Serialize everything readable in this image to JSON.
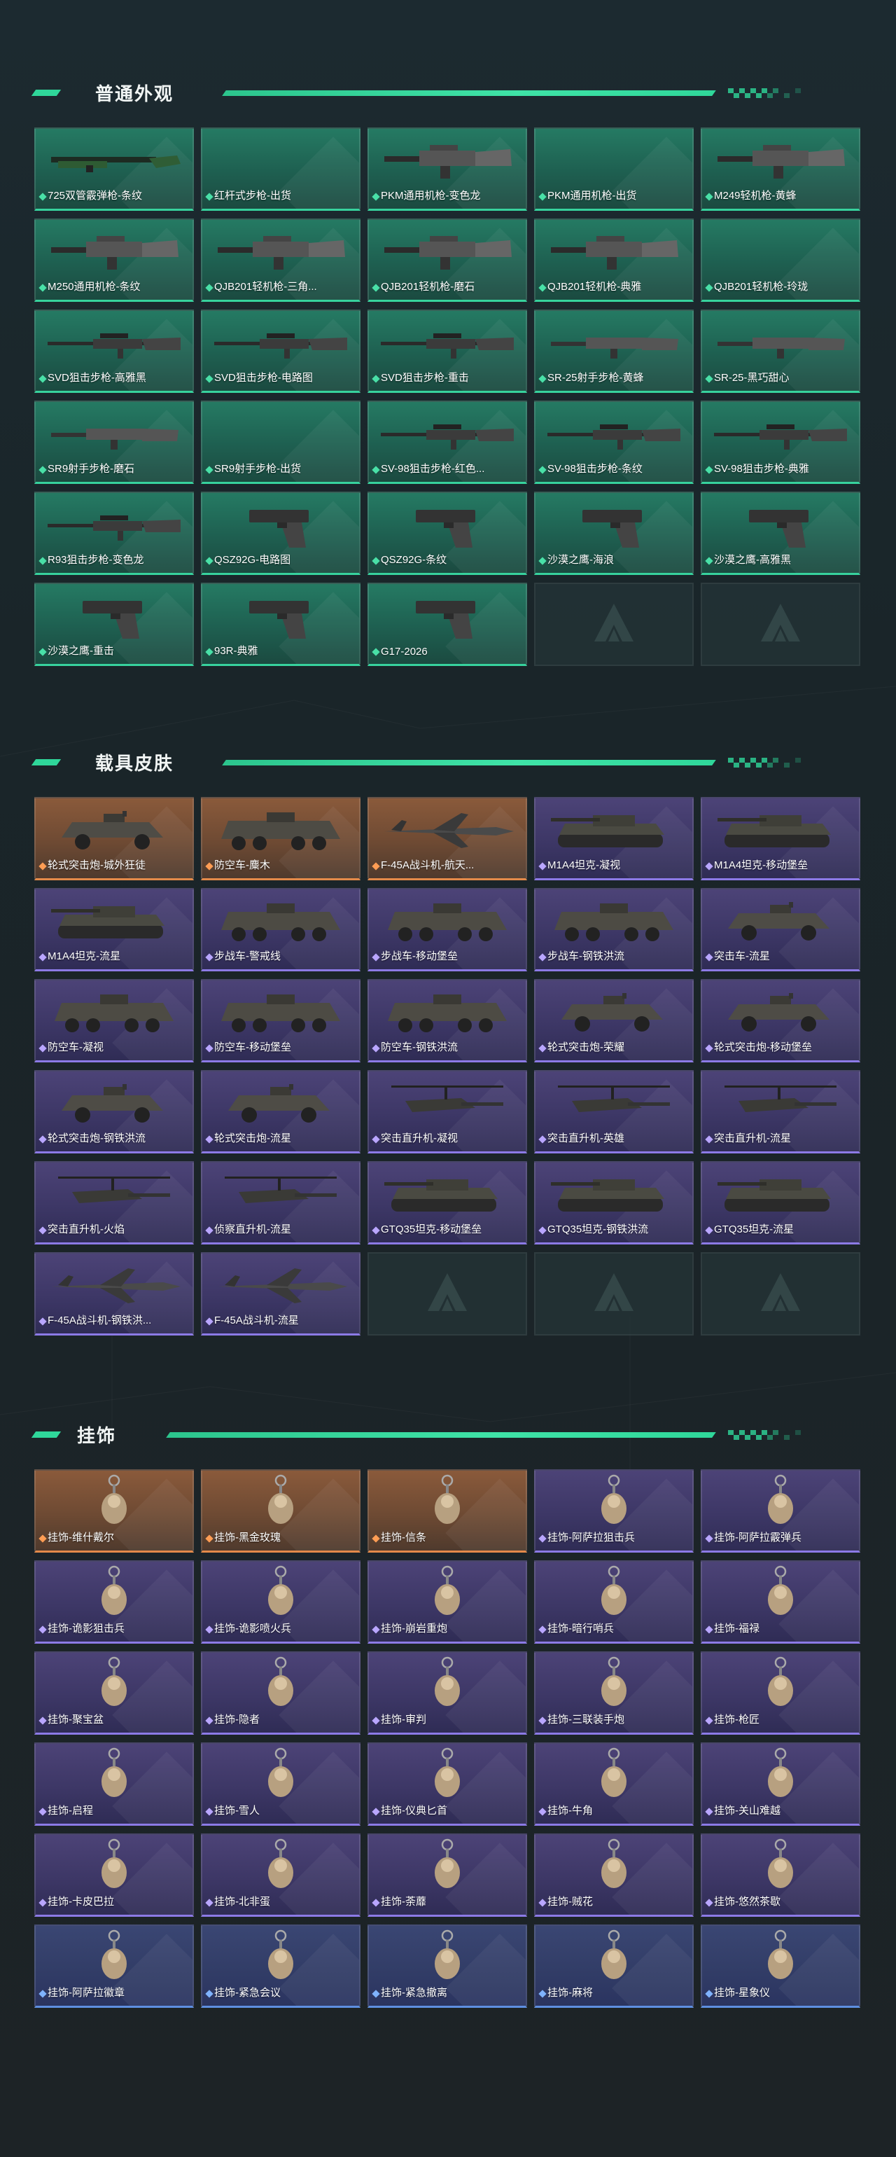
{
  "sections": [
    {
      "title": "普通外观",
      "items": [
        {
          "label": "725双管霰弹枪-条纹",
          "rarity": "green",
          "icon": "shotgun-icon"
        },
        {
          "label": "红杆式步枪-出货",
          "rarity": "green",
          "icon": "empty"
        },
        {
          "label": "PKM通用机枪-变色龙",
          "rarity": "green",
          "icon": "machine-gun-icon"
        },
        {
          "label": "PKM通用机枪-出货",
          "rarity": "green",
          "icon": "empty"
        },
        {
          "label": "M249轻机枪-黄蜂",
          "rarity": "green",
          "icon": "machine-gun-icon"
        },
        {
          "label": "M250通用机枪-条纹",
          "rarity": "green",
          "icon": "machine-gun-icon"
        },
        {
          "label": "QJB201轻机枪-三角...",
          "rarity": "green",
          "icon": "machine-gun-icon"
        },
        {
          "label": "QJB201轻机枪-磨石",
          "rarity": "green",
          "icon": "machine-gun-icon"
        },
        {
          "label": "QJB201轻机枪-典雅",
          "rarity": "green",
          "icon": "machine-gun-icon"
        },
        {
          "label": "QJB201轻机枪-玲珑",
          "rarity": "green",
          "icon": "empty"
        },
        {
          "label": "SVD狙击步枪-高雅黑",
          "rarity": "green",
          "icon": "sniper-rifle-icon"
        },
        {
          "label": "SVD狙击步枪-电路图",
          "rarity": "green",
          "icon": "sniper-rifle-icon"
        },
        {
          "label": "SVD狙击步枪-重击",
          "rarity": "green",
          "icon": "sniper-rifle-icon"
        },
        {
          "label": "SR-25射手步枪-黄蜂",
          "rarity": "green",
          "icon": "rifle-icon"
        },
        {
          "label": "SR-25-黑巧甜心",
          "rarity": "green",
          "icon": "rifle-icon"
        },
        {
          "label": "SR9射手步枪-磨石",
          "rarity": "green",
          "icon": "rifle-icon"
        },
        {
          "label": "SR9射手步枪-出货",
          "rarity": "green",
          "icon": "empty"
        },
        {
          "label": "SV-98狙击步枪-红色...",
          "rarity": "green",
          "icon": "sniper-rifle-icon"
        },
        {
          "label": "SV-98狙击步枪-条纹",
          "rarity": "green",
          "icon": "sniper-rifle-icon"
        },
        {
          "label": "SV-98狙击步枪-典雅",
          "rarity": "green",
          "icon": "sniper-rifle-icon"
        },
        {
          "label": "R93狙击步枪-变色龙",
          "rarity": "green",
          "icon": "sniper-rifle-icon"
        },
        {
          "label": "QSZ92G-电路图",
          "rarity": "green",
          "icon": "pistol-icon"
        },
        {
          "label": "QSZ92G-条纹",
          "rarity": "green",
          "icon": "pistol-icon"
        },
        {
          "label": "沙漠之鹰-海浪",
          "rarity": "green",
          "icon": "pistol-icon"
        },
        {
          "label": "沙漠之鹰-高雅黑",
          "rarity": "green",
          "icon": "pistol-icon"
        },
        {
          "label": "沙漠之鹰-重击",
          "rarity": "green",
          "icon": "pistol-icon"
        },
        {
          "label": "93R-典雅",
          "rarity": "green",
          "icon": "pistol-icon"
        },
        {
          "label": "G17-2026",
          "rarity": "green",
          "icon": "pistol-icon"
        },
        {
          "label": "",
          "rarity": "empty",
          "icon": "placeholder-logo-icon"
        },
        {
          "label": "",
          "rarity": "empty",
          "icon": "placeholder-logo-icon"
        }
      ]
    },
    {
      "title": "载具皮肤",
      "items": [
        {
          "label": "轮式突击炮-城外狂徒",
          "rarity": "orange",
          "icon": "armored-car-icon"
        },
        {
          "label": "防空车-麋木",
          "rarity": "orange",
          "icon": "apc-icon"
        },
        {
          "label": "F-45A战斗机-航天...",
          "rarity": "orange",
          "icon": "fighter-jet-icon"
        },
        {
          "label": "M1A4坦克-凝视",
          "rarity": "purple",
          "icon": "tank-icon"
        },
        {
          "label": "M1A4坦克-移动堡垒",
          "rarity": "purple",
          "icon": "tank-icon"
        },
        {
          "label": "M1A4坦克-流星",
          "rarity": "purple",
          "icon": "tank-icon"
        },
        {
          "label": "步战车-警戒线",
          "rarity": "purple",
          "icon": "apc-icon"
        },
        {
          "label": "步战车-移动堡垒",
          "rarity": "purple",
          "icon": "apc-icon"
        },
        {
          "label": "步战车-钢铁洪流",
          "rarity": "purple",
          "icon": "apc-icon"
        },
        {
          "label": "突击车-流星",
          "rarity": "purple",
          "icon": "armored-car-icon"
        },
        {
          "label": "防空车-凝视",
          "rarity": "purple",
          "icon": "apc-icon"
        },
        {
          "label": "防空车-移动堡垒",
          "rarity": "purple",
          "icon": "apc-icon"
        },
        {
          "label": "防空车-钢铁洪流",
          "rarity": "purple",
          "icon": "apc-icon"
        },
        {
          "label": "轮式突击炮-荣耀",
          "rarity": "purple",
          "icon": "armored-car-icon"
        },
        {
          "label": "轮式突击炮-移动堡垒",
          "rarity": "purple",
          "icon": "armored-car-icon"
        },
        {
          "label": "轮式突击炮-钢铁洪流",
          "rarity": "purple",
          "icon": "armored-car-icon"
        },
        {
          "label": "轮式突击炮-流星",
          "rarity": "purple",
          "icon": "armored-car-icon"
        },
        {
          "label": "突击直升机-凝视",
          "rarity": "purple",
          "icon": "helicopter-icon"
        },
        {
          "label": "突击直升机-英雄",
          "rarity": "purple",
          "icon": "helicopter-icon"
        },
        {
          "label": "突击直升机-流星",
          "rarity": "purple",
          "icon": "helicopter-icon"
        },
        {
          "label": "突击直升机-火焰",
          "rarity": "purple",
          "icon": "helicopter-icon"
        },
        {
          "label": "侦察直升机-流星",
          "rarity": "purple",
          "icon": "helicopter-icon"
        },
        {
          "label": "GTQ35坦克-移动堡垒",
          "rarity": "purple",
          "icon": "tank-icon"
        },
        {
          "label": "GTQ35坦克-钢铁洪流",
          "rarity": "purple",
          "icon": "tank-icon"
        },
        {
          "label": "GTQ35坦克-流星",
          "rarity": "purple",
          "icon": "tank-icon"
        },
        {
          "label": "F-45A战斗机-钢铁洪...",
          "rarity": "purple",
          "icon": "fighter-jet-icon"
        },
        {
          "label": "F-45A战斗机-流星",
          "rarity": "purple",
          "icon": "fighter-jet-icon"
        },
        {
          "label": "",
          "rarity": "empty",
          "icon": "placeholder-logo-icon"
        },
        {
          "label": "",
          "rarity": "empty",
          "icon": "placeholder-logo-icon"
        },
        {
          "label": "",
          "rarity": "empty",
          "icon": "placeholder-logo-icon"
        }
      ]
    },
    {
      "title": "挂饰",
      "items": [
        {
          "label": "挂饰-维什戴尔",
          "rarity": "orange",
          "icon": "charm-icon"
        },
        {
          "label": "挂饰-黑金玫瑰",
          "rarity": "orange",
          "icon": "charm-icon"
        },
        {
          "label": "挂饰-信条",
          "rarity": "orange",
          "icon": "charm-icon"
        },
        {
          "label": "挂饰-阿萨拉狙击兵",
          "rarity": "purple",
          "icon": "charm-icon"
        },
        {
          "label": "挂饰-阿萨拉霰弹兵",
          "rarity": "purple",
          "icon": "charm-icon"
        },
        {
          "label": "挂饰-诡影狙击兵",
          "rarity": "purple",
          "icon": "charm-icon"
        },
        {
          "label": "挂饰-诡影喷火兵",
          "rarity": "purple",
          "icon": "charm-icon"
        },
        {
          "label": "挂饰-崩岩重炮",
          "rarity": "purple",
          "icon": "charm-icon"
        },
        {
          "label": "挂饰-暗行哨兵",
          "rarity": "purple",
          "icon": "charm-icon"
        },
        {
          "label": "挂饰-福禄",
          "rarity": "purple",
          "icon": "charm-icon"
        },
        {
          "label": "挂饰-聚宝盆",
          "rarity": "purple",
          "icon": "charm-icon"
        },
        {
          "label": "挂饰-隐者",
          "rarity": "purple",
          "icon": "charm-icon"
        },
        {
          "label": "挂饰-审判",
          "rarity": "purple",
          "icon": "charm-icon"
        },
        {
          "label": "挂饰-三联装手炮",
          "rarity": "purple",
          "icon": "charm-icon"
        },
        {
          "label": "挂饰-枪匠",
          "rarity": "purple",
          "icon": "charm-icon"
        },
        {
          "label": "挂饰-启程",
          "rarity": "purple",
          "icon": "charm-icon"
        },
        {
          "label": "挂饰-雪人",
          "rarity": "purple",
          "icon": "charm-icon"
        },
        {
          "label": "挂饰-仪典匕首",
          "rarity": "purple",
          "icon": "charm-icon"
        },
        {
          "label": "挂饰-牛角",
          "rarity": "purple",
          "icon": "charm-icon"
        },
        {
          "label": "挂饰-关山难越",
          "rarity": "purple",
          "icon": "charm-icon"
        },
        {
          "label": "挂饰-卡皮巴拉",
          "rarity": "purple",
          "icon": "charm-icon"
        },
        {
          "label": "挂饰-北非蛋",
          "rarity": "purple",
          "icon": "charm-icon"
        },
        {
          "label": "挂饰-荼蘼",
          "rarity": "purple",
          "icon": "charm-icon"
        },
        {
          "label": "挂饰-贼花",
          "rarity": "purple",
          "icon": "charm-icon"
        },
        {
          "label": "挂饰-悠然茶歇",
          "rarity": "purple",
          "icon": "charm-icon"
        },
        {
          "label": "挂饰-阿萨拉徽章",
          "rarity": "blue",
          "icon": "charm-icon"
        },
        {
          "label": "挂饰-紧急会议",
          "rarity": "blue",
          "icon": "charm-icon"
        },
        {
          "label": "挂饰-紧急撤离",
          "rarity": "blue",
          "icon": "charm-icon"
        },
        {
          "label": "挂饰-麻将",
          "rarity": "blue",
          "icon": "charm-icon"
        },
        {
          "label": "挂饰-星象仪",
          "rarity": "blue",
          "icon": "charm-icon"
        }
      ]
    }
  ],
  "colors": {
    "accent": "#2fd79a",
    "green": "#257a63",
    "purple": "#4c4377",
    "orange": "#8a5a3b",
    "blue": "#3a4673",
    "background": "#1b2428"
  }
}
